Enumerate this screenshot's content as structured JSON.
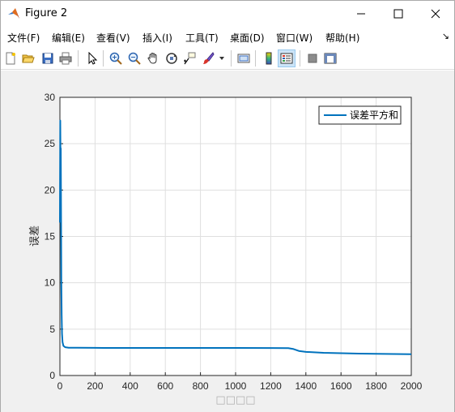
{
  "window": {
    "title": "Figure 2",
    "controls": [
      "minimize",
      "maximize",
      "close"
    ]
  },
  "menubar": {
    "items": [
      "文件(F)",
      "编辑(E)",
      "查看(V)",
      "插入(I)",
      "工具(T)",
      "桌面(D)",
      "窗口(W)",
      "帮助(H)"
    ],
    "overflow_glyph": "↘"
  },
  "toolbar": {
    "buttons": [
      {
        "icon": "new-figure-icon"
      },
      {
        "icon": "open-file-icon"
      },
      {
        "icon": "save-icon"
      },
      {
        "icon": "print-icon"
      },
      {
        "icon": "pointer-icon"
      },
      {
        "icon": "zoom-in-icon"
      },
      {
        "icon": "zoom-out-icon"
      },
      {
        "icon": "pan-icon"
      },
      {
        "icon": "rotate-3d-icon"
      },
      {
        "icon": "data-cursor-icon"
      },
      {
        "icon": "brush-icon"
      },
      {
        "icon": "link-plot-icon"
      },
      {
        "icon": "colorbar-icon"
      },
      {
        "icon": "legend-icon",
        "active": true
      },
      {
        "icon": "hide-plot-tools-icon"
      },
      {
        "icon": "show-plot-tools-icon"
      }
    ]
  },
  "colors": {
    "line": "#0072BD",
    "figure_bg": "#f0f0f0",
    "grid": "#dfdfdf"
  },
  "chart_data": {
    "type": "line",
    "title": "",
    "xlabel": "□□□□",
    "ylabel": "误差",
    "xlim": [
      0,
      2000
    ],
    "ylim": [
      0,
      30
    ],
    "xticks": [
      0,
      200,
      400,
      600,
      800,
      1000,
      1200,
      1400,
      1600,
      1800,
      2000
    ],
    "yticks": [
      0,
      5,
      10,
      15,
      20,
      25,
      30
    ],
    "grid": true,
    "legend_position": "top-right",
    "series": [
      {
        "name": "误差平方和",
        "x": [
          0,
          2,
          4,
          5,
          6,
          7,
          8,
          10,
          12,
          15,
          20,
          30,
          50,
          100,
          200,
          400,
          600,
          800,
          1000,
          1200,
          1300,
          1330,
          1360,
          1400,
          1500,
          1600,
          1700,
          1800,
          1900,
          2000
        ],
        "y": [
          16.5,
          27.5,
          22,
          24.5,
          20,
          15,
          10,
          6.5,
          4.5,
          3.6,
          3.2,
          3.05,
          3.0,
          3.0,
          2.98,
          2.97,
          2.97,
          2.97,
          2.97,
          2.96,
          2.95,
          2.85,
          2.65,
          2.55,
          2.45,
          2.4,
          2.36,
          2.34,
          2.32,
          2.3
        ]
      }
    ]
  }
}
